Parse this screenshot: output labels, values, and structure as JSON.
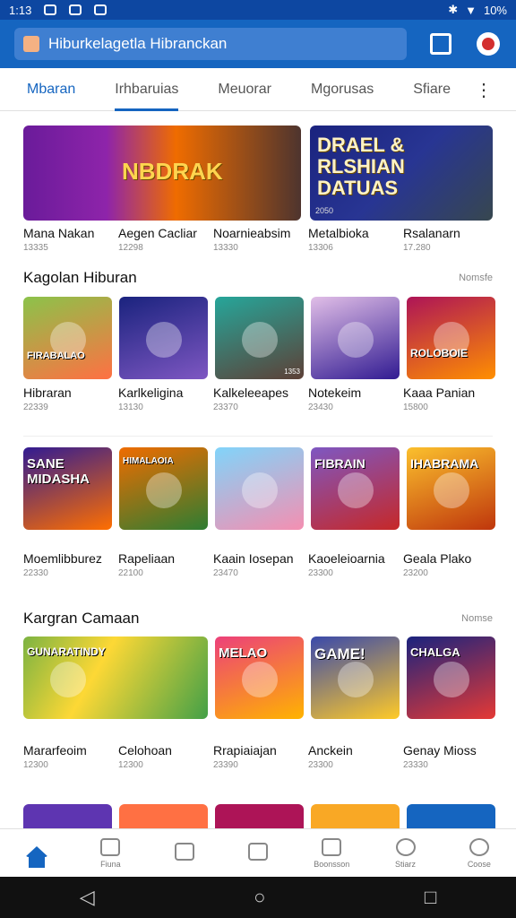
{
  "status": {
    "time": "1:13",
    "battery": "10%"
  },
  "search": {
    "placeholder": "Hiburkelagetla Hibranckan"
  },
  "tabs": [
    "Mbaran",
    "Irhbaruias",
    "Meuorar",
    "Mgorusas",
    "Sfiare"
  ],
  "banners": [
    {
      "title": "NBDRAK"
    },
    {
      "title": "DRAEL & RLSHIAN DATUAS",
      "small": "2050"
    }
  ],
  "banner_labels": [
    {
      "name": "Mana Nakan",
      "sub": "13335"
    },
    {
      "name": "Aegen Cacliar",
      "sub": "12298"
    },
    {
      "name": "Noarnieabsim",
      "sub": "13330"
    },
    {
      "name": "Metalbioka",
      "sub": "13306"
    },
    {
      "name": "Rsalanarn",
      "sub": "17.280"
    }
  ],
  "section1": {
    "title": "Kagolan Hiburan",
    "more": "Nomsfe",
    "tiles": [
      {
        "title": "FIRABALAO",
        "num": "",
        "bg": "#6ab04c"
      },
      {
        "title": "",
        "num": "",
        "bg": "#2e1a6e"
      },
      {
        "title": "",
        "num": "1353",
        "bg": "#00897b"
      },
      {
        "title": "",
        "num": "",
        "bg": "#4a148c"
      },
      {
        "title": "ROLOBOIE",
        "num": "",
        "bg": "#c2185b"
      }
    ],
    "labels": [
      {
        "name": "Hibraran",
        "sub": "22339"
      },
      {
        "name": "Karlkeligina",
        "sub": "13130"
      },
      {
        "name": "Kalkeleeapes",
        "sub": "23370"
      },
      {
        "name": "Notekeim",
        "sub": "23430"
      },
      {
        "name": "Kaaa Panian",
        "sub": "15800"
      }
    ]
  },
  "section2": {
    "tiles": [
      {
        "title": "SANE MIDASHA",
        "num": "",
        "bg": "#311b92"
      },
      {
        "title": "HIMALAOIA",
        "num": "",
        "bg": "#e65100"
      },
      {
        "title": "",
        "num": "",
        "bg": "#4fc3f7"
      },
      {
        "title": "FIBRAIN",
        "num": "",
        "bg": "#5e35b1"
      },
      {
        "title": "IHABRAMA",
        "num": "",
        "bg": "#f9a825"
      }
    ],
    "labels": [
      {
        "name": "Moemlibburez",
        "sub": "22330"
      },
      {
        "name": "Rapeliaan",
        "sub": "22100"
      },
      {
        "name": "Kaain Iosepan",
        "sub": "23470"
      },
      {
        "name": "Kaoeleioarnia",
        "sub": "23300"
      },
      {
        "name": "Geala Plako",
        "sub": "23200"
      }
    ]
  },
  "section3": {
    "title": "Kargran Camaan",
    "more": "Nomse",
    "tiles": [
      {
        "title": "GUNARATINDY",
        "num": "",
        "bg": "#7cb342"
      },
      {
        "title": "",
        "num": "",
        "bg": "#43a047"
      },
      {
        "title": "MELAO",
        "num": "",
        "bg": "#ec407a"
      },
      {
        "title": "GAME!",
        "num": "",
        "bg": "#3949ab"
      },
      {
        "title": "CHALGA",
        "num": "",
        "bg": "#1a237e"
      }
    ],
    "labels": [
      {
        "name": "Mararfeoim",
        "sub": "12300"
      },
      {
        "name": "Celohoan",
        "sub": "12300"
      },
      {
        "name": "Rrapiaiajan",
        "sub": "23390"
      },
      {
        "name": "Anckein",
        "sub": "23300"
      },
      {
        "name": "Genay Mioss",
        "sub": "23330"
      }
    ]
  },
  "bottomnav": [
    {
      "label": "",
      "icon": "home-icon"
    },
    {
      "label": "Fiuna",
      "icon": "store-icon"
    },
    {
      "label": "",
      "icon": "cards-icon"
    },
    {
      "label": "",
      "icon": "house-icon"
    },
    {
      "label": "Boonsson",
      "icon": "monitor-icon"
    },
    {
      "label": "Stiarz",
      "icon": "heart-icon"
    },
    {
      "label": "Coose",
      "icon": "search-icon"
    }
  ],
  "sysnav": {
    "back": "◁",
    "home": "○",
    "recent": "□"
  }
}
